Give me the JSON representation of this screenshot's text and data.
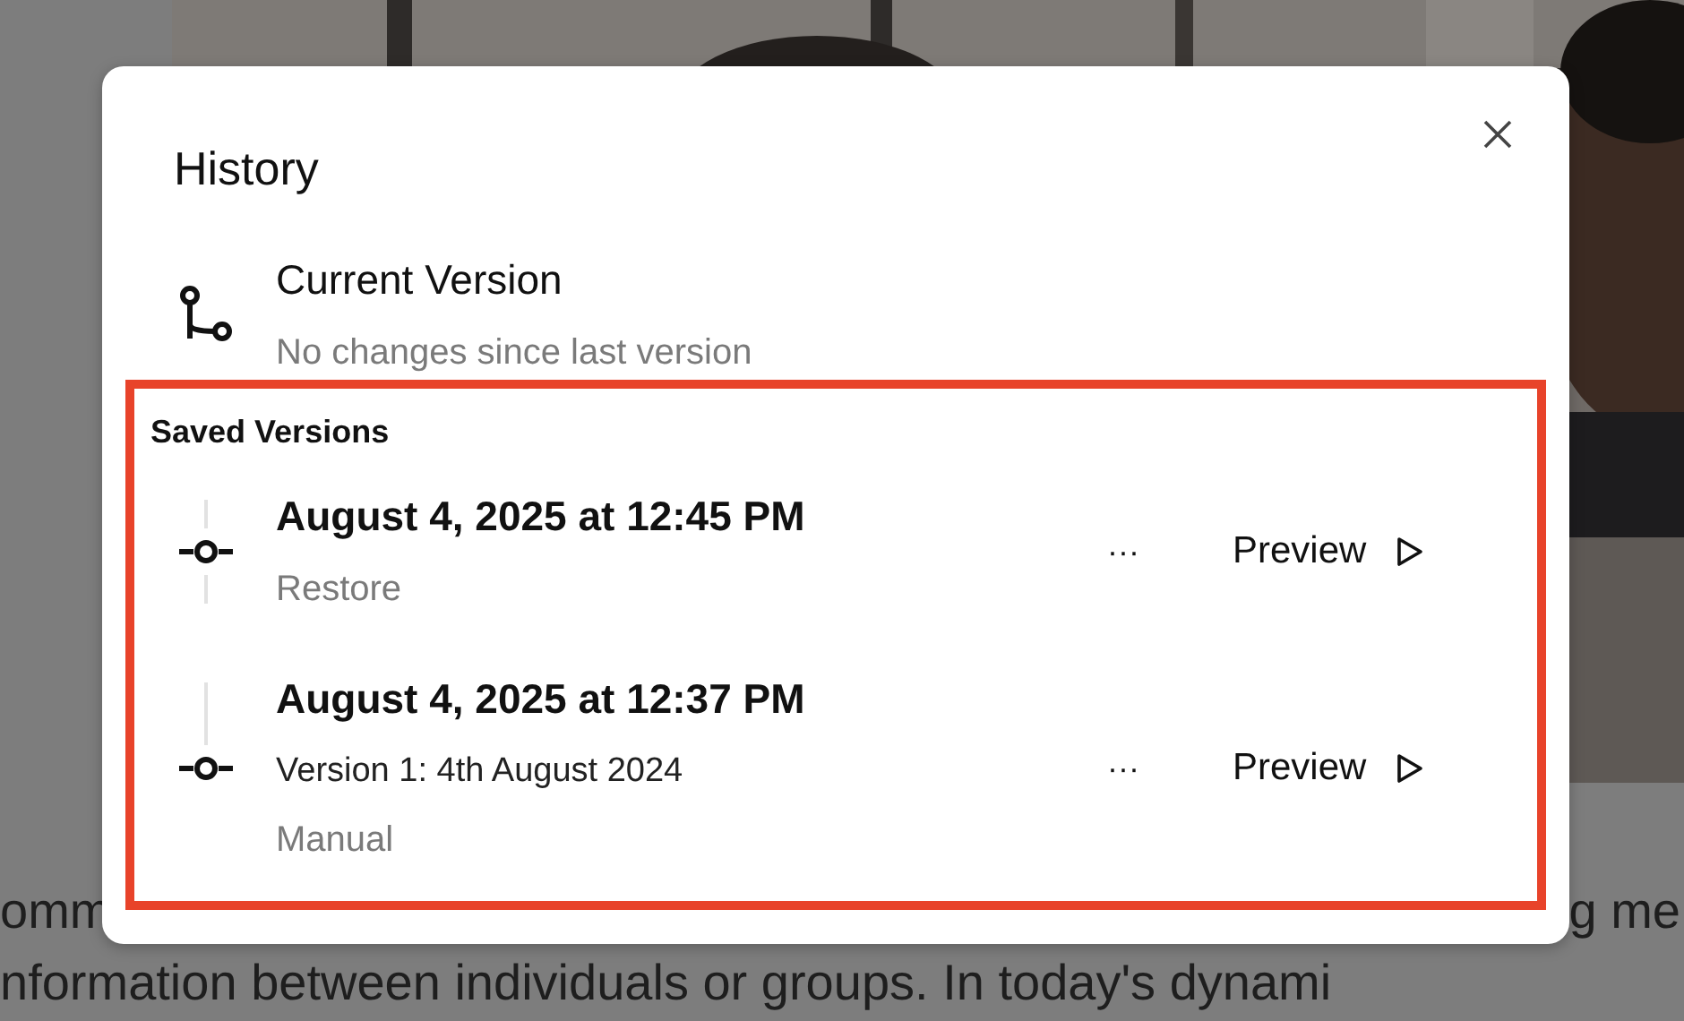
{
  "background": {
    "text_lines": [
      {
        "pieces": [
          "omm",
          "g me"
        ]
      },
      {
        "pieces": [
          "nformation between individuals or groups. In today's dynami"
        ]
      }
    ]
  },
  "dialog": {
    "title": "History",
    "current_version": {
      "title": "Current Version",
      "subtitle": "No changes since last version"
    },
    "saved_versions": {
      "heading": "Saved Versions",
      "items": [
        {
          "date": "August 4, 2025 at 12:45 PM",
          "lines": [
            {
              "kind": "muted",
              "text": "Restore"
            }
          ],
          "menu": "···",
          "action": "Preview"
        },
        {
          "date": "August 4, 2025 at 12:37 PM",
          "lines": [
            {
              "kind": "label",
              "text": "Version 1: 4th August 2024"
            },
            {
              "kind": "muted",
              "text": "Manual"
            }
          ],
          "menu": "···",
          "action": "Preview"
        }
      ]
    }
  }
}
